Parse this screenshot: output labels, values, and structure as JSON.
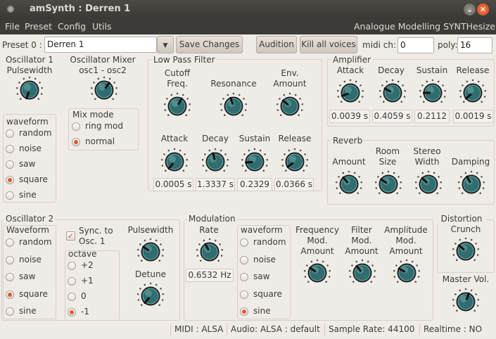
{
  "window": {
    "title": "amSynth : Derren 1",
    "minimize_glyph": "⌄",
    "close_glyph": "✕"
  },
  "menubar": {
    "items": [
      "File",
      "Preset",
      "Config",
      "Utils"
    ],
    "right_label": "Analogue Modelling SYNTHesizer"
  },
  "toolbar": {
    "preset_label": "Preset 0 :",
    "preset_name": "Derren 1",
    "dropdown_glyph": "▼",
    "save_label": "Save Changes",
    "audition_label": "Audition",
    "kill_label": "Kill all voices",
    "midi_ch_label": "midi ch:",
    "midi_ch_value": "0",
    "poly_label": "poly:",
    "poly_value": "16"
  },
  "osc1": {
    "title": "Oscillator 1",
    "pulsewidth_label": "Pulsewidth",
    "waveform_label": "waveform",
    "waveforms": [
      "random",
      "noise",
      "saw",
      "square",
      "sine"
    ],
    "selected": "square"
  },
  "mixer": {
    "title": "Oscillator Mixer",
    "subtitle": "osc1  -  osc2",
    "mix_mode_label": "Mix mode",
    "modes": [
      "ring mod",
      "normal"
    ],
    "selected": "normal"
  },
  "lpf": {
    "title": "Low Pass Filter",
    "cutoff_label": "Cutoff Freq.",
    "resonance_label": "Resonance",
    "env_label": "Env. Amount",
    "attack_label": "Attack",
    "decay_label": "Decay",
    "sustain_label": "Sustain",
    "release_label": "Release",
    "attack_value": "0.0005 s",
    "decay_value": "1.3337 s",
    "sustain_value": "0.2329",
    "release_value": "0.0366 s"
  },
  "amp": {
    "title": "Amplifier",
    "attack_label": "Attack",
    "decay_label": "Decay",
    "sustain_label": "Sustain",
    "release_label": "Release",
    "attack_value": "0.0039 s",
    "decay_value": "0.4059 s",
    "sustain_value": "0.2112",
    "release_value": "0.0019 s"
  },
  "reverb": {
    "title": "Reverb",
    "amount_label": "Amount",
    "room_label": "Room Size",
    "stereo_label": "Stereo Width",
    "damping_label": "Damping"
  },
  "osc2": {
    "title": "Oscillator 2",
    "waveform_label": "Waveform",
    "waveforms": [
      "random",
      "noise",
      "saw",
      "square",
      "sine"
    ],
    "selected": "square",
    "sync_label": "Sync. to Osc. 1",
    "sync_checked": true,
    "octave_label": "octave",
    "octaves": [
      "+2",
      "+1",
      "0",
      "-1"
    ],
    "octave_selected": "-1",
    "pulsewidth_label": "Pulsewidth",
    "detune_label": "Detune"
  },
  "modulation": {
    "title": "Modulation",
    "rate_label": "Rate",
    "rate_value": "0.6532 Hz",
    "waveform_label": "waveform",
    "waveforms": [
      "random",
      "noise",
      "saw",
      "square",
      "sine"
    ],
    "selected": "sine",
    "freq_label": "Frequency Mod. Amount",
    "filter_label": "Filter Mod. Amount",
    "amp_label": "Amplitude Mod. Amount"
  },
  "distortion": {
    "title": "Distortion",
    "crunch_label": "Crunch",
    "master_label": "Master Vol."
  },
  "status": {
    "midi": "MIDI : ALSA",
    "audio": "Audio: ALSA : default",
    "sample_rate": "Sample Rate: 44100",
    "realtime": "Realtime : NO"
  },
  "colors": {
    "knob_face": "#2f6d70",
    "radio_on": "#e05a2b",
    "titlebar": "#3c3b37"
  }
}
